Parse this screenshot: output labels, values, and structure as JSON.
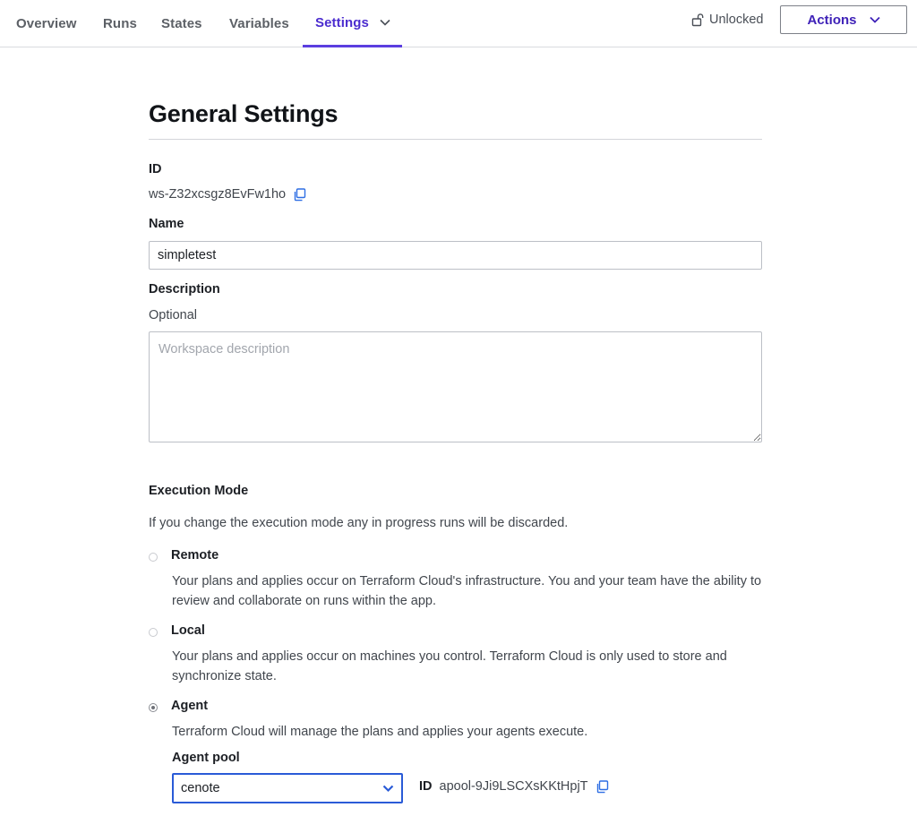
{
  "nav": {
    "tabs": [
      {
        "label": "Overview"
      },
      {
        "label": "Runs"
      },
      {
        "label": "States"
      },
      {
        "label": "Variables"
      },
      {
        "label": "Settings",
        "active": true
      }
    ],
    "lock_status": "Unlocked",
    "actions_label": "Actions"
  },
  "page": {
    "title": "General Settings"
  },
  "fields": {
    "id_label": "ID",
    "id_value": "ws-Z32xcsgz8EvFw1ho",
    "name_label": "Name",
    "name_value": "simpletest",
    "description_label": "Description",
    "description_hint": "Optional",
    "description_placeholder": "Workspace description"
  },
  "execution": {
    "label": "Execution Mode",
    "warning": "If you change the execution mode any in progress runs will be discarded.",
    "options": [
      {
        "title": "Remote",
        "description": "Your plans and applies occur on Terraform Cloud's infrastructure. You and your team have the ability to review and collaborate on runs within the app.",
        "selected": false
      },
      {
        "title": "Local",
        "description": "Your plans and applies occur on machines you control. Terraform Cloud is only used to store and synchronize state.",
        "selected": false
      },
      {
        "title": "Agent",
        "description": "Terraform Cloud will manage the plans and applies your agents execute.",
        "selected": true
      }
    ],
    "agent_pool_label": "Agent pool",
    "agent_pool_value": "cenote",
    "agent_pool_id_label": "ID",
    "agent_pool_id": "apool-9Ji9LSCXsKKtHpjT"
  },
  "colors": {
    "accent": "#5b3ee0",
    "focus": "#2a5bd7",
    "link_icon": "#2f6fe4"
  },
  "icons": {
    "lock": "unlock-icon",
    "copy": "copy-icon",
    "chevron": "chevron-down-icon"
  }
}
